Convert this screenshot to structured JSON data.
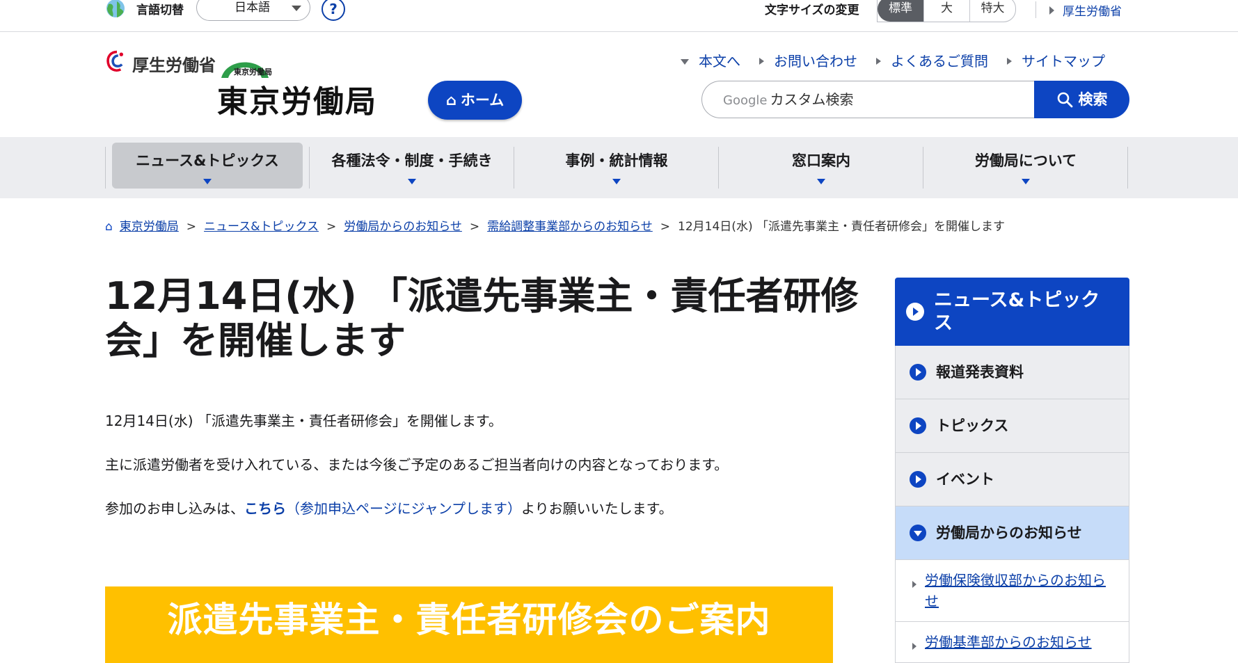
{
  "topbar": {
    "lang_label": "言語切替",
    "lang_selected": "日本語",
    "help": "?",
    "fontsize_label": "文字サイズの変更",
    "fontsize_options": [
      "標準",
      "大",
      "特大"
    ],
    "mhlw_link": "厚生労働省"
  },
  "header": {
    "ministry_name": "厚生労働省",
    "bureau_small": "東京労働局",
    "site_title": "東京労働局",
    "home_button": "ホーム",
    "links": [
      "本文へ",
      "お問い合わせ",
      "よくあるご質問",
      "サイトマップ"
    ],
    "search_brand": "Google",
    "search_placeholder": "カスタム検索",
    "search_button": "検索"
  },
  "gnav": [
    "ニュース&トピックス",
    "各種法令・制度・手続き",
    "事例・統計情報",
    "窓口案内",
    "労働局について"
  ],
  "breadcrumb": {
    "items": [
      "東京労働局",
      "ニュース&トピックス",
      "労働局からのお知らせ",
      "需給調整事業部からのお知らせ"
    ],
    "current": "12月14日(水) 「派遣先事業主・責任者研修会」を開催します",
    "sep": ">"
  },
  "main": {
    "title": "12月14日(水) 「派遣先事業主・責任者研修会」を開催します",
    "p1": "12月14日(水) 「派遣先事業主・責任者研修会」を開催します。",
    "p2": "主に派遣労働者を受け入れている、または今後ご予定のあるご担当者向けの内容となっております。",
    "p3_prefix": "参加のお申し込みは、",
    "p3_link_bold": "こちら",
    "p3_link_rest": "（参加申込ページにジャンプします）",
    "p3_suffix": "よりお願いいたします。",
    "banner": "派遣先事業主・責任者研修会のご案内"
  },
  "sidebar": {
    "heading": "ニュース&トピックス",
    "items": [
      "報道発表資料",
      "トピックス",
      "イベント",
      "労働局からのお知らせ"
    ],
    "subitems": [
      "労働保険徴収部からのお知らせ",
      "労働基準部からのお知らせ"
    ]
  },
  "colors": {
    "primary_blue": "#0d45c2",
    "nav_gray": "#ecedf0",
    "active_side": "#c6dcf9",
    "banner_yellow": "#ffc000"
  }
}
